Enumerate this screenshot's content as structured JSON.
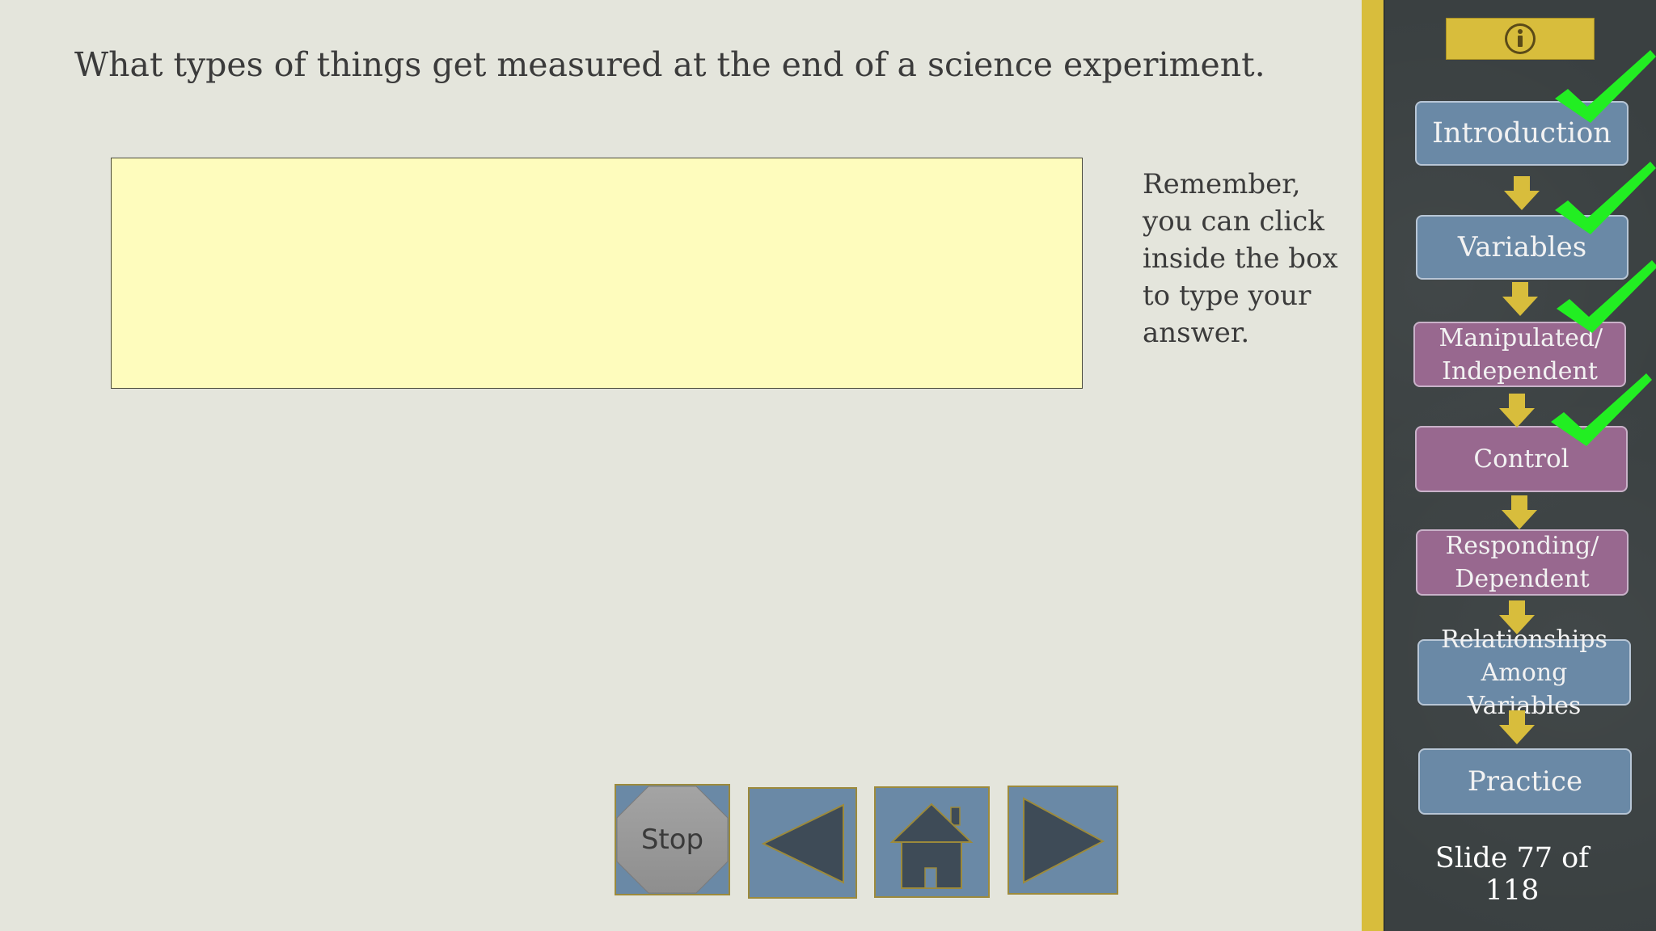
{
  "question": "What types of things get measured at the end of a science experiment.",
  "reminder": "Remember, you can click inside the box to type your answer.",
  "answer": {
    "value": ""
  },
  "nav": {
    "stop_label": "Stop"
  },
  "sidebar": {
    "steps": [
      {
        "label": "Introduction",
        "completed": true
      },
      {
        "label": "Variables",
        "completed": true
      },
      {
        "label": "Manipulated/ Independent",
        "completed": true
      },
      {
        "label": "Control",
        "completed": true
      },
      {
        "label": "Responding/ Dependent",
        "completed": false
      },
      {
        "label": "Relationships Among Variables",
        "completed": false
      },
      {
        "label": "Practice",
        "completed": false
      }
    ],
    "slide_counter": "Slide 77 of 118"
  },
  "colors": {
    "accent_gold": "#d8bd3c",
    "step_blue": "#6a89a6",
    "step_purple": "#98688f",
    "check_green": "#22ee22",
    "answer_bg": "#fefcbd"
  }
}
